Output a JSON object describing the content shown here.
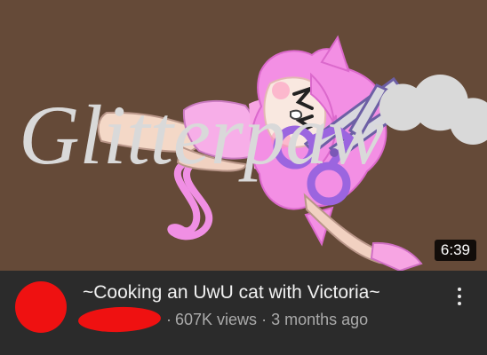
{
  "video": {
    "title": "~Cooking an UwU cat with Victoria~",
    "duration": "6:39",
    "views": "607K views",
    "age": "3 months ago",
    "separator": "·",
    "watermark_text": "Glitterpaw"
  },
  "colors": {
    "thumbnail_background": "#654a38",
    "redaction": "#ef1111",
    "info_background": "#2b2b2b",
    "title_text": "#f1f1f1",
    "meta_text": "#aaaaaa"
  },
  "icons": {
    "more": "more-vertical-icon",
    "scissors": "scissors-illustration"
  }
}
